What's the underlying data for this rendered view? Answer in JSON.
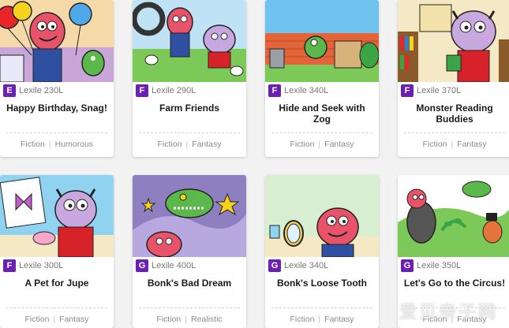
{
  "books": [
    {
      "level": "E",
      "lexile": "Lexile 230L",
      "title": "Happy Birthday, Snag!",
      "genres": [
        "Fiction",
        "Humorous"
      ]
    },
    {
      "level": "F",
      "lexile": "Lexile 290L",
      "title": "Farm Friends",
      "genres": [
        "Fiction",
        "Fantasy"
      ]
    },
    {
      "level": "F",
      "lexile": "Lexile 340L",
      "title": "Hide and Seek with Zog",
      "genres": [
        "Fiction",
        "Fantasy"
      ]
    },
    {
      "level": "F",
      "lexile": "Lexile 370L",
      "title": "Monster Reading Buddies",
      "genres": [
        "Fiction",
        "Fantasy"
      ]
    },
    {
      "level": "F",
      "lexile": "Lexile 300L",
      "title": "A Pet for Jupe",
      "genres": [
        "Fiction",
        "Fantasy"
      ]
    },
    {
      "level": "G",
      "lexile": "Lexile 400L",
      "title": "Bonk's Bad Dream",
      "genres": [
        "Fiction",
        "Realistic"
      ]
    },
    {
      "level": "G",
      "lexile": "Lexile 340L",
      "title": "Bonk's Loose Tooth",
      "genres": [
        "Fiction",
        "Fantasy"
      ]
    },
    {
      "level": "G",
      "lexile": "Lexile 350L",
      "title": "Let's Go to the Circus!",
      "genres": [
        "Fiction",
        "Fantasy"
      ]
    }
  ],
  "separator": "|",
  "watermark": "爱贝亲子网",
  "colors": {
    "level_badge": "#6b1fb3"
  }
}
